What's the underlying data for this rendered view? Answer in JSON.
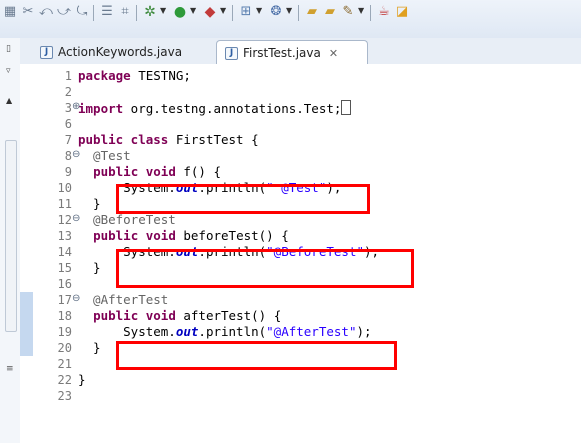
{
  "toolbar": {
    "icons": [
      "perspective-icon",
      "coverage-icon",
      "back-icon",
      "forward-icon",
      "last-edit-icon",
      "outline-icon",
      "filter-icon",
      "debug-icon",
      "run-icon",
      "external-tools-icon",
      "new-class-icon",
      "new-project-icon",
      "open-folder-icon",
      "open-file-icon",
      "pencil-icon",
      "perspective-java-icon"
    ]
  },
  "tabs": [
    {
      "label": "ActionKeywords.java",
      "active": false
    },
    {
      "label": "FirstTest.java",
      "active": true,
      "close": "✕"
    }
  ],
  "editor": {
    "lines": [
      {
        "n": "1",
        "segments": [
          {
            "t": "kw",
            "v": "package"
          },
          {
            "t": "p",
            "v": " TESTNG;"
          }
        ]
      },
      {
        "n": "2",
        "segments": []
      },
      {
        "n": "3",
        "fold": "⊕",
        "segments": [
          {
            "t": "kw",
            "v": "import"
          },
          {
            "t": "p",
            "v": " org.testng.annotations.Test;"
          }
        ],
        "box": true
      },
      {
        "n": "6",
        "segments": []
      },
      {
        "n": "7",
        "segments": [
          {
            "t": "kw",
            "v": "public class"
          },
          {
            "t": "p",
            "v": " FirstTest {"
          }
        ]
      },
      {
        "n": "8",
        "fold": "⊖",
        "segments": [
          {
            "t": "ann",
            "v": "  @Test"
          }
        ]
      },
      {
        "n": "9",
        "segments": [
          {
            "t": "p",
            "v": "  "
          },
          {
            "t": "kw",
            "v": "public void"
          },
          {
            "t": "p",
            "v": " f() {"
          }
        ]
      },
      {
        "n": "10",
        "segments": [
          {
            "t": "p",
            "v": "      System."
          },
          {
            "t": "fld",
            "v": "out"
          },
          {
            "t": "p",
            "v": ".println("
          },
          {
            "t": "str",
            "v": "\" @Test\""
          },
          {
            "t": "p",
            "v": ");"
          }
        ]
      },
      {
        "n": "11",
        "segments": [
          {
            "t": "p",
            "v": "  }"
          }
        ]
      },
      {
        "n": "12",
        "fold": "⊖",
        "segments": [
          {
            "t": "ann",
            "v": "  @BeforeTest"
          }
        ]
      },
      {
        "n": "13",
        "segments": [
          {
            "t": "p",
            "v": "  "
          },
          {
            "t": "kw",
            "v": "public void"
          },
          {
            "t": "p",
            "v": " beforeTest() {"
          }
        ]
      },
      {
        "n": "14",
        "segments": [
          {
            "t": "p",
            "v": "      System."
          },
          {
            "t": "fld",
            "v": "out"
          },
          {
            "t": "p",
            "v": ".println("
          },
          {
            "t": "str",
            "v": "\"@BeforeTest\""
          },
          {
            "t": "p",
            "v": ");"
          }
        ]
      },
      {
        "n": "15",
        "segments": [
          {
            "t": "p",
            "v": "  }"
          }
        ]
      },
      {
        "n": "16",
        "segments": []
      },
      {
        "n": "17",
        "fold": "⊖",
        "segments": [
          {
            "t": "ann",
            "v": "  @AfterTest"
          }
        ]
      },
      {
        "n": "18",
        "segments": [
          {
            "t": "p",
            "v": "  "
          },
          {
            "t": "kw",
            "v": "public void"
          },
          {
            "t": "p",
            "v": " afterTest() {"
          }
        ]
      },
      {
        "n": "19",
        "segments": [
          {
            "t": "p",
            "v": "      System."
          },
          {
            "t": "fld",
            "v": "out"
          },
          {
            "t": "p",
            "v": ".println("
          },
          {
            "t": "str",
            "v": "\"@AfterTest\""
          },
          {
            "t": "p",
            "v": ");"
          }
        ]
      },
      {
        "n": "20",
        "segments": [
          {
            "t": "p",
            "v": "  }"
          }
        ]
      },
      {
        "n": "21",
        "segments": []
      },
      {
        "n": "22",
        "segments": [
          {
            "t": "p",
            "v": "}"
          }
        ]
      },
      {
        "n": "23",
        "segments": []
      }
    ]
  },
  "colors": {
    "keyword": "#7f0055",
    "string": "#2a00ff",
    "field": "#0000c0",
    "annotation": "#646464",
    "highlight_box": "#ff0000",
    "current_line_gutter": "#c5d8ef"
  }
}
